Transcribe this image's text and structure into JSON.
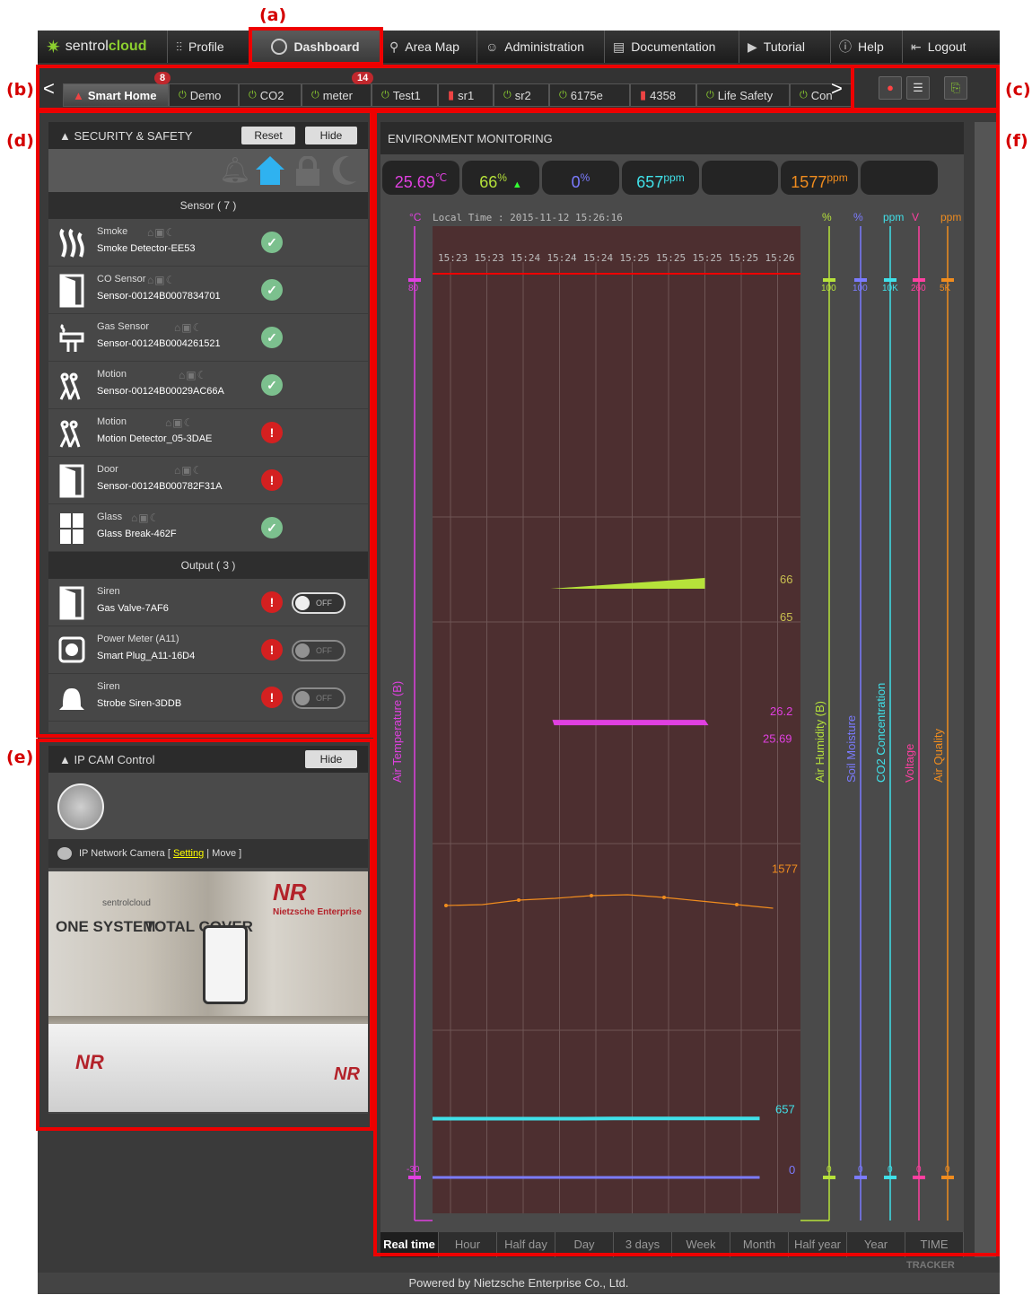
{
  "annotations": {
    "a": "(a)",
    "b": "(b)",
    "c": "(c)",
    "d": "(d)",
    "e": "(e)",
    "f": "(f)"
  },
  "nav": {
    "logo_prefix": "sentrol",
    "logo_suffix": "cloud",
    "items": [
      "Profile",
      "Dashboard",
      "Area Map",
      "Administration",
      "Documentation",
      "Tutorial",
      "Help",
      "Logout"
    ],
    "active": "Dashboard"
  },
  "tabs": {
    "prev": "<",
    "next": ">",
    "items": [
      {
        "label": "Smart Home",
        "badge": "8",
        "icon": "alert"
      },
      {
        "label": "Demo",
        "icon": "power"
      },
      {
        "label": "CO2",
        "icon": "power"
      },
      {
        "label": "meter",
        "badge": "14",
        "icon": "power"
      },
      {
        "label": "Test1",
        "icon": "power"
      },
      {
        "label": "sr1",
        "icon": "battery"
      },
      {
        "label": "sr2",
        "icon": "power"
      },
      {
        "label": "6175e",
        "icon": "power"
      },
      {
        "label": "4358",
        "icon": "battery"
      },
      {
        "label": "Life Safety",
        "icon": "power"
      },
      {
        "label": "Con",
        "icon": "power"
      }
    ]
  },
  "security": {
    "title": "▲ SECURITY & SAFETY",
    "reset": "Reset",
    "hide": "Hide",
    "sensor_header": "Sensor ( 7 )",
    "output_header": "Output ( 3 )",
    "sensors": [
      {
        "type": "Smoke",
        "name": "Smoke Detector-EE53",
        "status": "ok"
      },
      {
        "type": "CO Sensor",
        "name": "Sensor-00124B0007834701",
        "status": "ok"
      },
      {
        "type": "Gas Sensor",
        "name": "Sensor-00124B0004261521",
        "status": "ok"
      },
      {
        "type": "Motion",
        "name": "Sensor-00124B00029AC66A",
        "status": "ok"
      },
      {
        "type": "Motion",
        "name": "Motion Detector_05-3DAE",
        "status": "alert"
      },
      {
        "type": "Door",
        "name": "Sensor-00124B000782F31A",
        "status": "alert"
      },
      {
        "type": "Glass",
        "name": "Glass Break-462F",
        "status": "ok"
      }
    ],
    "outputs": [
      {
        "type": "Siren",
        "name": "Gas Valve-7AF6",
        "toggle": "OFF"
      },
      {
        "type": "Power Meter (A11)",
        "name": "Smart Plug_A11-16D4",
        "toggle": "OFF"
      },
      {
        "type": "Siren",
        "name": "Strobe Siren-3DDB",
        "toggle": "OFF"
      }
    ]
  },
  "cam": {
    "title": "▲ IP CAM Control",
    "hide": "Hide",
    "camera_prefix": "IP Network Camera [ ",
    "setting": "Setting",
    "sep": " | Move ]",
    "photo_texts": {
      "one_system": "ONE SYSTEM",
      "total_cover": "TOTAL COVER",
      "nr": "NR",
      "brand": "sentrolcloud",
      "enterprise": "Nietzsche Enterprise"
    }
  },
  "env": {
    "title": "ENVIRONMENT MONITORING",
    "readings": [
      {
        "value": "25.69",
        "unit": "℃",
        "color": "#e040e0"
      },
      {
        "value": "66",
        "unit": "%",
        "color": "#b6e23a",
        "trend": "▲"
      },
      {
        "value": "0",
        "unit": "%",
        "color": "#7b7bff"
      },
      {
        "value": "657",
        "unit": "ppm",
        "color": "#40e0e8"
      },
      {
        "value": "",
        "unit": "",
        "color": "#888"
      },
      {
        "value": "1577",
        "unit": "ppm",
        "color": "#f08c1e"
      },
      {
        "value": "",
        "unit": "",
        "color": "#888"
      }
    ],
    "local_time": "Local Time : 2015-11-12 15:26:16",
    "time_range": [
      "Real time",
      "Hour",
      "Half day",
      "Day",
      "3 days",
      "Week",
      "Month",
      "Half year",
      "Year",
      "TIME"
    ],
    "tracker": "TRACKER"
  },
  "chart_data": {
    "type": "line",
    "x": [
      "15:23",
      "15:23",
      "15:24",
      "15:24",
      "15:24",
      "15:25",
      "15:25",
      "15:25",
      "15:25",
      "15:26"
    ],
    "axes": [
      {
        "name": "Air Temperature (B)",
        "unit": "°C",
        "min": -30,
        "max": 80,
        "color": "#e040e0"
      },
      {
        "name": "Air Humidity (B)",
        "unit": "%",
        "min": 0,
        "max": 100,
        "color": "#b6e23a"
      },
      {
        "name": "Soil Moisture",
        "unit": "%",
        "min": 0,
        "max": 100,
        "color": "#7b7bff"
      },
      {
        "name": "CO2 Concentration",
        "unit": "ppm",
        "min": 0,
        "max": "10K",
        "color": "#40e0e8"
      },
      {
        "name": "Voltage",
        "unit": "V",
        "min": 0,
        "max": 260,
        "color": "#ff3fa0"
      },
      {
        "name": "Air Quality",
        "unit": "ppm",
        "min": 0,
        "max": "5K",
        "color": "#f08c1e"
      }
    ],
    "series": [
      {
        "name": "Air Humidity (B)",
        "values": [
          65,
          66
        ],
        "labels": [
          "66",
          "65"
        ]
      },
      {
        "name": "Air Temperature (B)",
        "values": [
          26.2,
          25.69
        ],
        "labels": [
          "26.2",
          "25.69"
        ]
      },
      {
        "name": "Air Quality",
        "values": [
          1515,
          1520,
          1545,
          1555,
          1570,
          1575,
          1560,
          1540,
          1520,
          1500
        ],
        "label": "1577"
      },
      {
        "name": "CO2 Concentration",
        "values": [
          655,
          655,
          655,
          655,
          655,
          657,
          657,
          657,
          657,
          657
        ],
        "label": "657"
      },
      {
        "name": "Soil Moisture",
        "values": [
          0,
          0,
          0,
          0,
          0,
          0,
          0,
          0,
          0,
          0
        ],
        "label": "0"
      }
    ]
  },
  "footer": "Powered by Nietzsche Enterprise Co., Ltd."
}
